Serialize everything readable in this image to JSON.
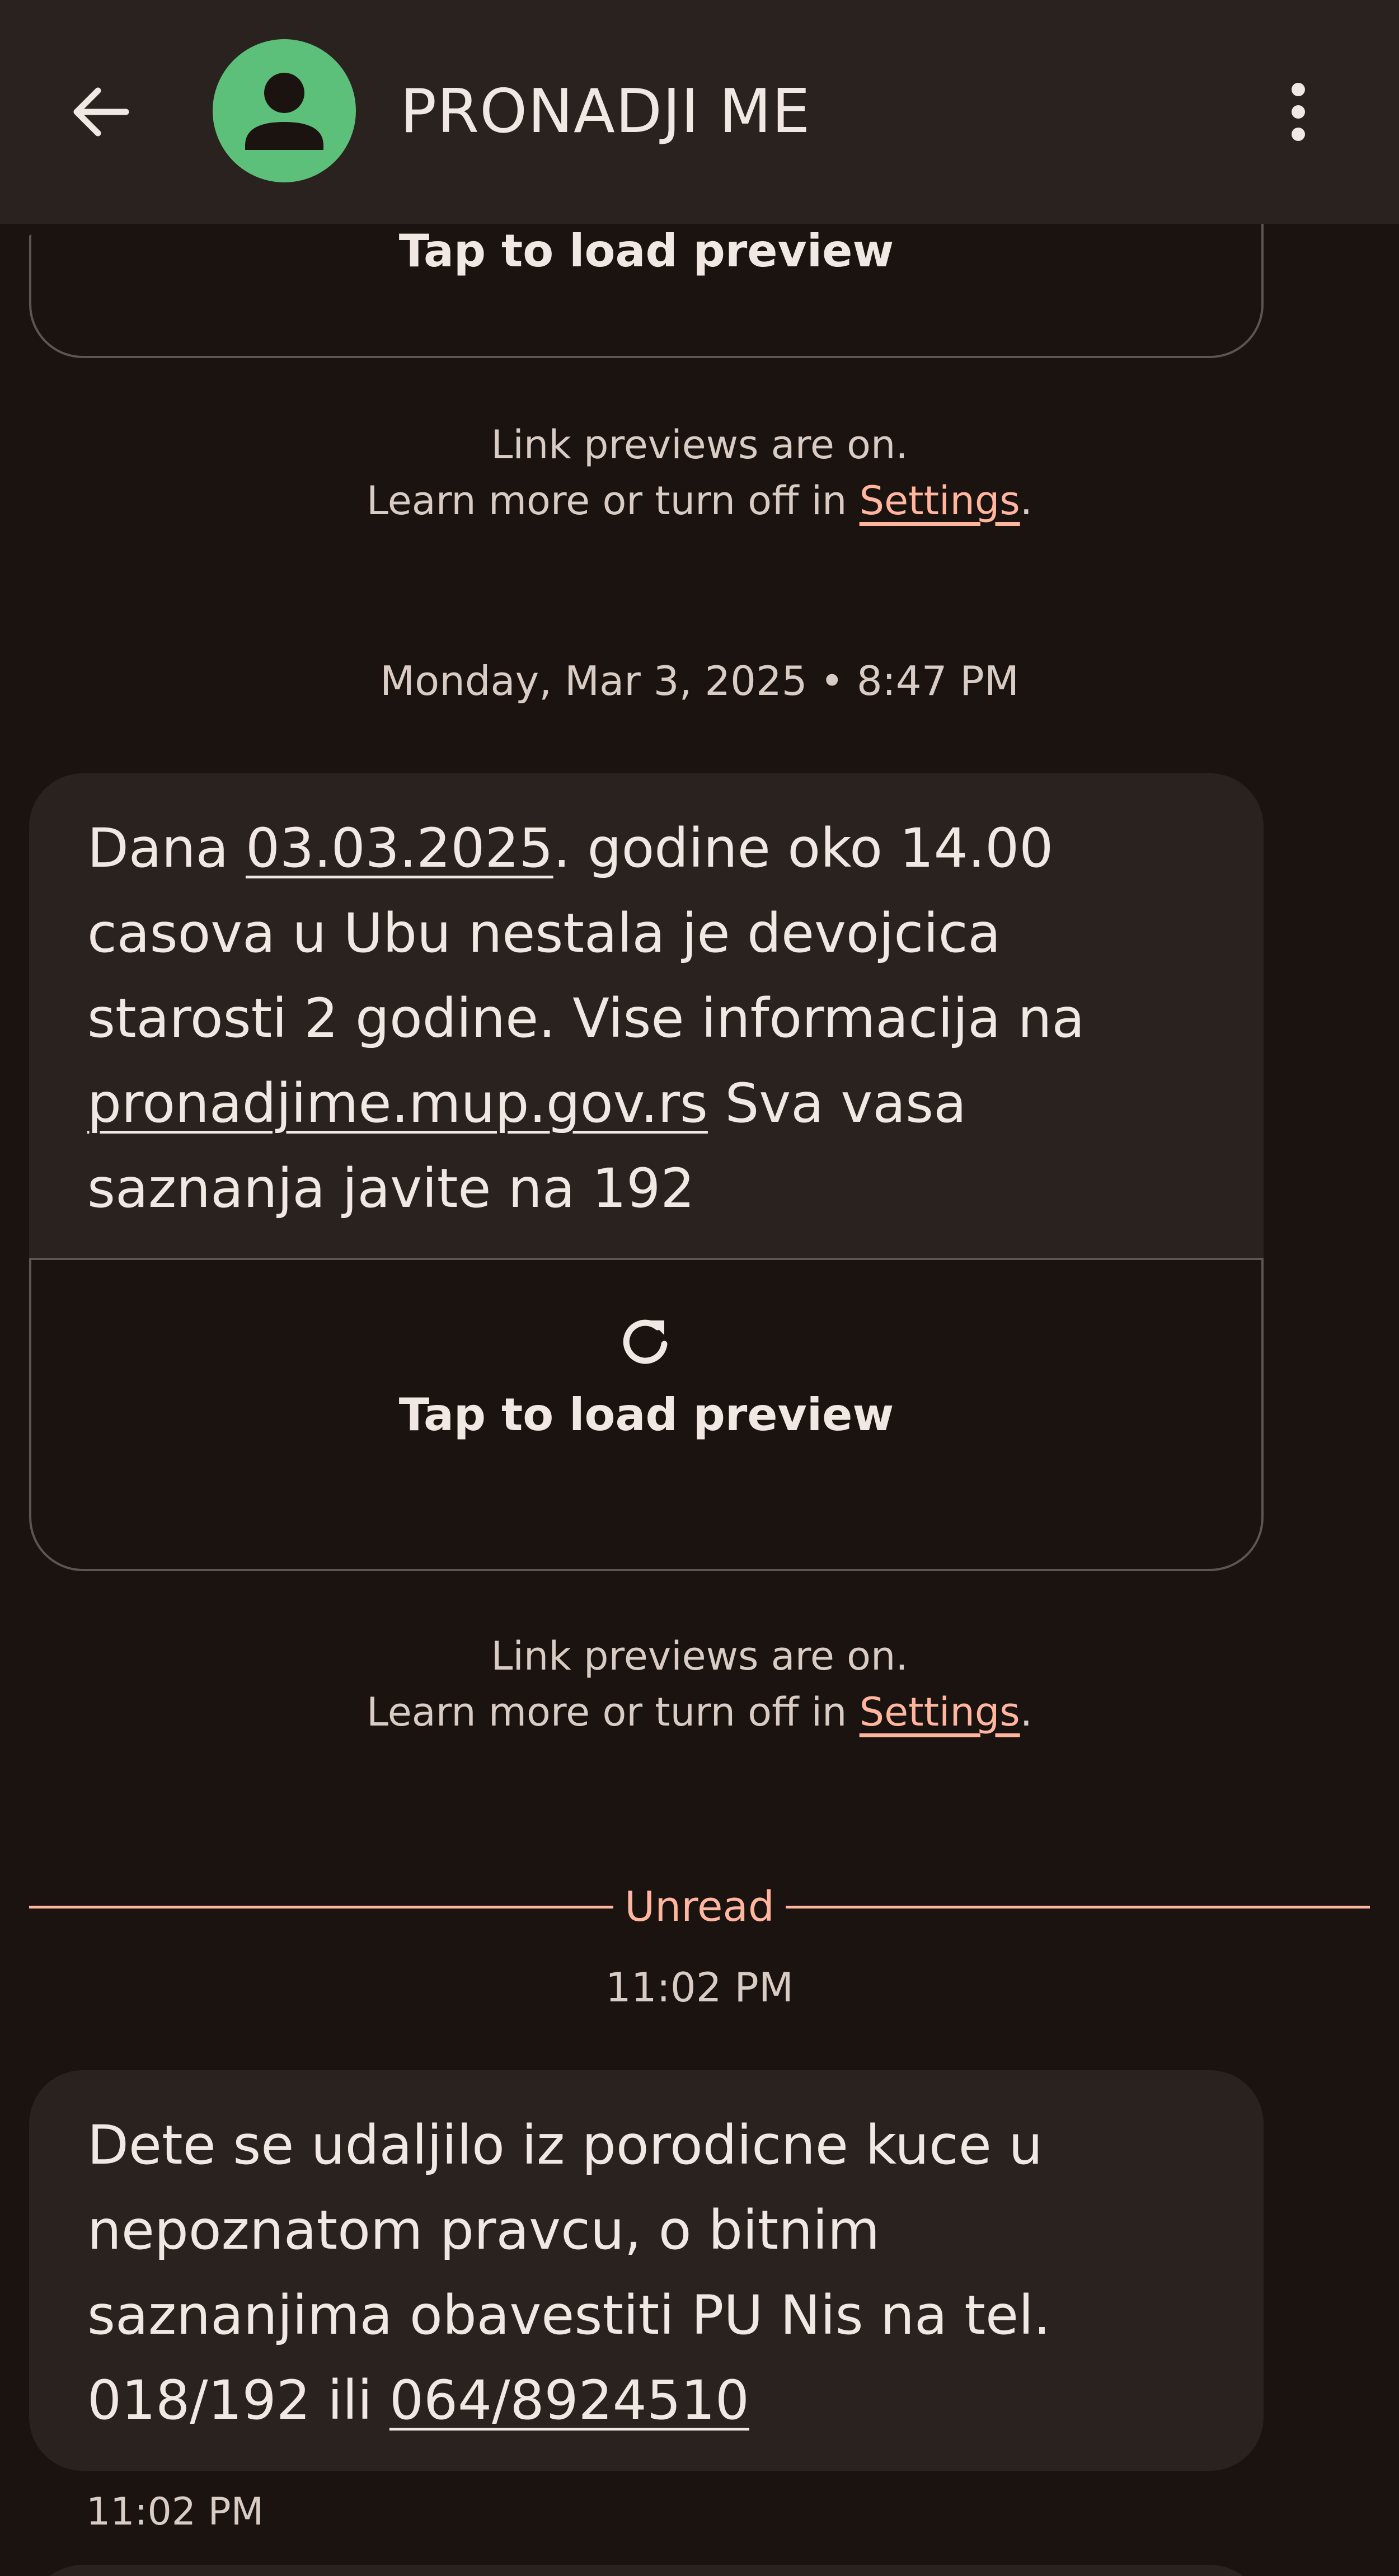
{
  "header": {
    "back_icon": "arrow-left-icon",
    "avatar_icon": "person-icon",
    "contact_name": "PRONADJI ME",
    "more_icon": "more-vert-icon"
  },
  "conversation": {
    "preview_top": {
      "label": "Tap to load preview"
    },
    "notice_1": {
      "line1": "Link previews are on.",
      "line2_prefix": "Learn more or turn off in ",
      "line2_link": "Settings",
      "line2_suffix": "."
    },
    "date_header": "Monday, Mar 3, 2025 • 8:47 PM",
    "message_1": {
      "t1": "Dana ",
      "link_date": "03.03.2025",
      "t2": ". godine oko 14.00 casova u Ubu nestala je devojcica starosti 2 godine. Vise informacija na ",
      "link_url": "pronadjime.mup.gov.rs",
      "t3": " Sva vasa saznanja javite na 192"
    },
    "preview_1": {
      "icon": "reload-icon",
      "label": "Tap to load preview"
    },
    "notice_2": {
      "line1": "Link previews are on.",
      "line2_prefix": "Learn more or turn off in ",
      "line2_link": "Settings",
      "line2_suffix": "."
    },
    "unread_label": "Unread",
    "unread_time": "11:02 PM",
    "message_2": {
      "t1": "Dete se udaljilo iz porodicne kuce u nepoznatom pravcu, o bitnim saznanjima obavestiti PU Nis na tel. 018/192 ili ",
      "link_phone": "064/8924510"
    },
    "message_2_time": "11:02 PM"
  },
  "colors": {
    "background": "#1b1310",
    "app_bar": "#2a221f",
    "bubble": "#2a221f",
    "avatar": "#5cbf7a",
    "accent": "#ffb59e"
  }
}
